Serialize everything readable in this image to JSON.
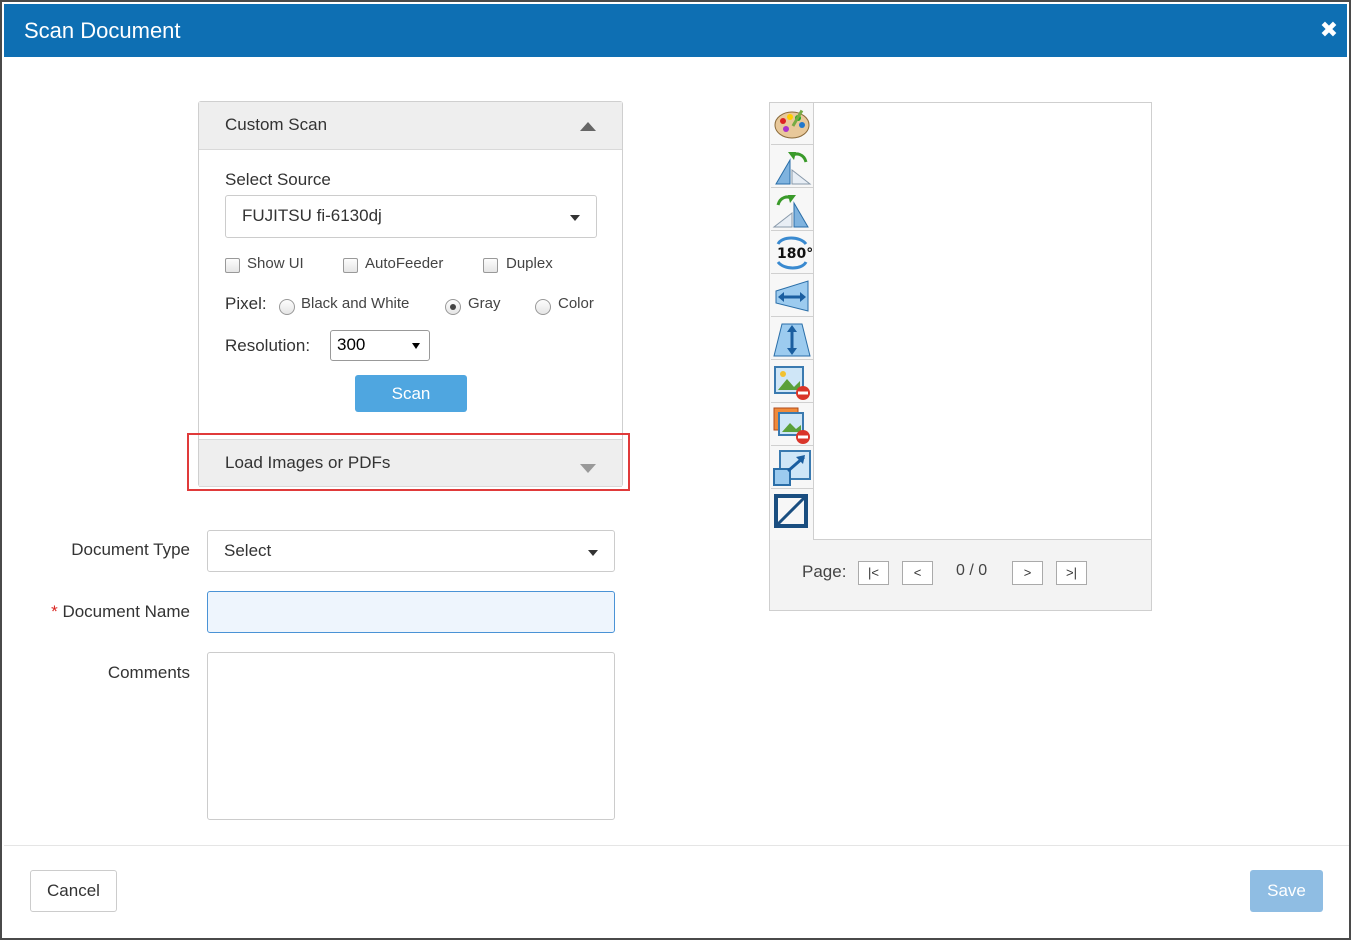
{
  "dialog": {
    "title": "Scan Document",
    "close_icon": "close-icon"
  },
  "custom_scan": {
    "header": "Custom Scan",
    "select_source_label": "Select Source",
    "source_value": "FUJITSU fi-6130dj",
    "checkboxes": [
      {
        "label": "Show UI",
        "checked": false
      },
      {
        "label": "AutoFeeder",
        "checked": false
      },
      {
        "label": "Duplex",
        "checked": false
      }
    ],
    "pixel_label": "Pixel:",
    "pixel_options": [
      {
        "label": "Black and White",
        "selected": false
      },
      {
        "label": "Gray",
        "selected": true
      },
      {
        "label": "Color",
        "selected": false
      }
    ],
    "resolution_label": "Resolution:",
    "resolution_value": "300",
    "scan_button": "Scan"
  },
  "load_images": {
    "header": "Load Images or PDFs"
  },
  "form": {
    "document_type_label": "Document Type",
    "document_type_value": "Select",
    "required_marker": "*",
    "document_name_label": "Document Name",
    "document_name_value": "",
    "comments_label": "Comments",
    "comments_value": ""
  },
  "viewer": {
    "tools": [
      "color-palette-icon",
      "rotate-left-icon",
      "rotate-right-icon",
      "rotate-180-icon",
      "flip-horizontal-icon",
      "flip-vertical-icon",
      "remove-image-icon",
      "remove-all-images-icon",
      "resize-icon",
      "crop-icon"
    ],
    "page_label": "Page:",
    "first_button": "|<",
    "prev_button": "<",
    "page_count": "0 / 0",
    "next_button": ">",
    "last_button": ">|"
  },
  "footer": {
    "cancel_button": "Cancel",
    "save_button": "Save"
  },
  "colors": {
    "titlebar": "#0e6fb3",
    "scan_button": "#4fa6e0",
    "save_button_disabled": "#8fbde3",
    "highlight": "#e03a3a"
  }
}
